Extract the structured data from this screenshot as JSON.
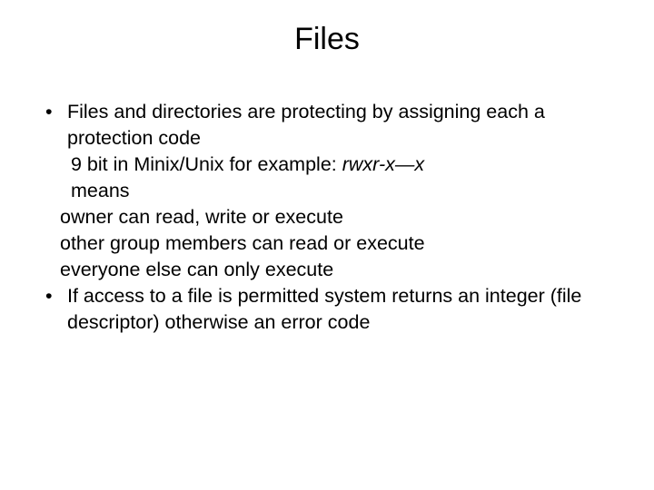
{
  "slide": {
    "title": "Files",
    "bullet1": "Files and directories are protecting by assigning each a protection code",
    "line_example_prefix": "9 bit in Minix/Unix for example: ",
    "line_example_code": "rwxr-x—x",
    "line_means": "means",
    "line_owner": "owner can read, write or execute",
    "line_group": "other group members can read or execute",
    "line_everyone": "everyone else can only execute",
    "bullet2": "If access to a file is permitted system returns an integer (file descriptor) otherwise an error code",
    "bullet_char": "•"
  }
}
